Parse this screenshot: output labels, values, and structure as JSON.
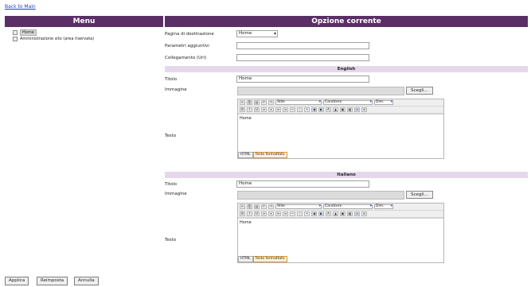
{
  "back_link": "Back to Main",
  "menu": {
    "title": "Menu",
    "items": [
      {
        "label": "Home"
      },
      {
        "label": "Amministrazione sito (area riservata)"
      }
    ]
  },
  "options": {
    "title": "Opzione corrente",
    "pagina_label": "Pagina di destinazione",
    "pagina_value": "Home",
    "parametri_label": "Parametri aggiuntivi",
    "parametri_value": "",
    "collegamento_label": "Collegamento (Url)",
    "collegamento_value": ""
  },
  "languages": [
    {
      "name": "English",
      "titolo_label": "Titolo",
      "titolo_value": "Home",
      "immagine_label": "Immagine",
      "scegli": "Scegli...",
      "testo_label": "Testo",
      "testo_value": "Home",
      "font_sel": "Stile",
      "family_sel": "Carattere",
      "size_sel": "Dim.",
      "tab_html": "HTML",
      "tab_formatted": "Testo formattato"
    },
    {
      "name": "Italiano",
      "titolo_label": "Titolo",
      "titolo_value": "Home",
      "immagine_label": "Immagine",
      "scegli": "Scegli...",
      "testo_label": "Testo",
      "testo_value": "Home",
      "font_sel": "Stile",
      "family_sel": "Carattere",
      "size_sel": "Dim.",
      "tab_html": "HTML",
      "tab_formatted": "Testo formattato"
    }
  ],
  "buttons": {
    "apply": "Applica",
    "reset": "Reimposta",
    "cancel": "Annulla"
  },
  "colors": {
    "header_bg": "#5a2f66",
    "lang_bar_bg": "#e5d8ec",
    "link": "#1a3cc7"
  }
}
